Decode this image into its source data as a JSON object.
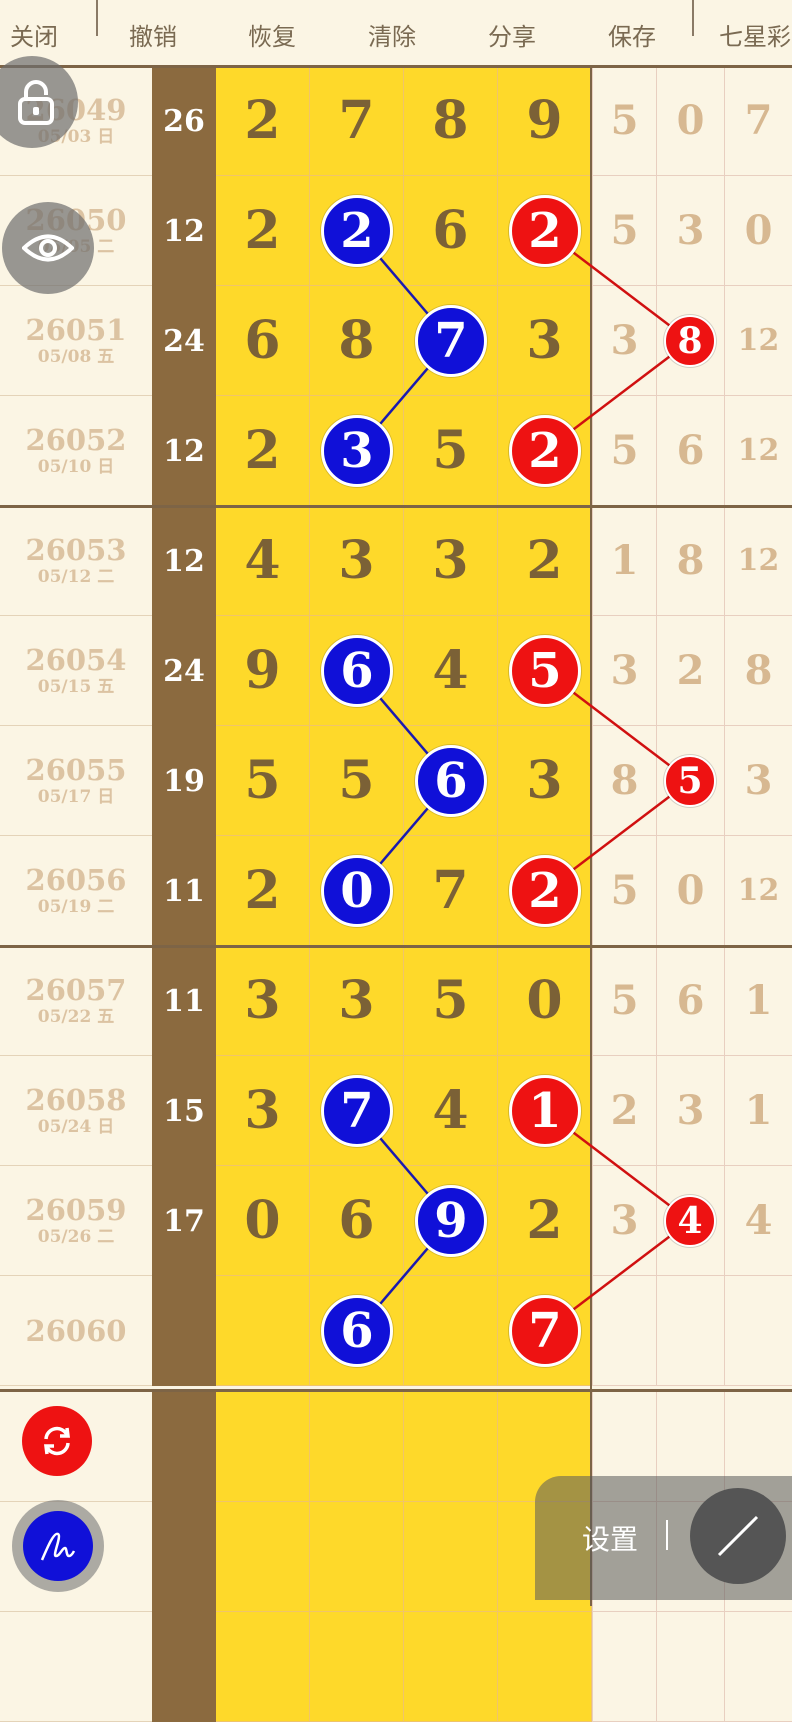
{
  "toolbar": {
    "items": [
      {
        "label": "关闭",
        "icon": "star-icon"
      },
      {
        "label": "撤销",
        "icon": "undo-icon"
      },
      {
        "label": "恢复",
        "icon": "redo-icon"
      },
      {
        "label": "清除",
        "icon": "clear-icon"
      },
      {
        "label": "分享",
        "icon": "share-icon"
      },
      {
        "label": "保存",
        "icon": "save-icon"
      },
      {
        "label": "七星彩",
        "icon": ""
      }
    ]
  },
  "rows": [
    {
      "issue": "26049",
      "date": "05/03 日",
      "sum": "26",
      "digits": [
        "2",
        "7",
        "8",
        "9"
      ],
      "extra": [
        "5",
        "0",
        "7"
      ]
    },
    {
      "issue": "26050",
      "date": "05/05 二",
      "sum": "12",
      "digits": [
        "2",
        "2",
        "6",
        "2"
      ],
      "extra": [
        "5",
        "3",
        "0"
      ]
    },
    {
      "issue": "26051",
      "date": "05/08 五",
      "sum": "24",
      "digits": [
        "6",
        "8",
        "7",
        "3"
      ],
      "extra": [
        "3",
        "8",
        "12"
      ]
    },
    {
      "issue": "26052",
      "date": "05/10 日",
      "sum": "12",
      "digits": [
        "2",
        "3",
        "5",
        "2"
      ],
      "extra": [
        "5",
        "6",
        "12"
      ]
    },
    {
      "issue": "26053",
      "date": "05/12 二",
      "sum": "12",
      "digits": [
        "4",
        "3",
        "3",
        "2"
      ],
      "extra": [
        "1",
        "8",
        "12"
      ]
    },
    {
      "issue": "26054",
      "date": "05/15 五",
      "sum": "24",
      "digits": [
        "9",
        "6",
        "4",
        "5"
      ],
      "extra": [
        "3",
        "2",
        "8"
      ]
    },
    {
      "issue": "26055",
      "date": "05/17 日",
      "sum": "19",
      "digits": [
        "5",
        "5",
        "6",
        "3"
      ],
      "extra": [
        "8",
        "5",
        "3"
      ]
    },
    {
      "issue": "26056",
      "date": "05/19 二",
      "sum": "11",
      "digits": [
        "2",
        "0",
        "7",
        "2"
      ],
      "extra": [
        "5",
        "0",
        "12"
      ]
    },
    {
      "issue": "26057",
      "date": "05/22 五",
      "sum": "11",
      "digits": [
        "3",
        "3",
        "5",
        "0"
      ],
      "extra": [
        "5",
        "6",
        "1"
      ]
    },
    {
      "issue": "26058",
      "date": "05/24 日",
      "sum": "15",
      "digits": [
        "3",
        "7",
        "4",
        "1"
      ],
      "extra": [
        "2",
        "3",
        "1"
      ]
    },
    {
      "issue": "26059",
      "date": "05/26 二",
      "sum": "17",
      "digits": [
        "0",
        "6",
        "9",
        "2"
      ],
      "extra": [
        "3",
        "4",
        "4"
      ]
    },
    {
      "issue": "26060",
      "date": "",
      "sum": "",
      "digits": [
        "",
        "6",
        "",
        "7"
      ],
      "extra": [
        "",
        "",
        ""
      ]
    }
  ],
  "marks": {
    "blue": [
      {
        "row": 1,
        "col": 1,
        "value": "2"
      },
      {
        "row": 2,
        "col": 2,
        "value": "7"
      },
      {
        "row": 3,
        "col": 1,
        "value": "3"
      },
      {
        "row": 5,
        "col": 1,
        "value": "6"
      },
      {
        "row": 6,
        "col": 2,
        "value": "6"
      },
      {
        "row": 7,
        "col": 1,
        "value": "0"
      },
      {
        "row": 9,
        "col": 1,
        "value": "7"
      },
      {
        "row": 10,
        "col": 2,
        "value": "9"
      },
      {
        "row": 11,
        "col": 1,
        "value": "6"
      }
    ],
    "red": [
      {
        "row": 1,
        "col": 3,
        "value": "2"
      },
      {
        "row": 2,
        "col": 5,
        "value": "8"
      },
      {
        "row": 3,
        "col": 3,
        "value": "2"
      },
      {
        "row": 5,
        "col": 3,
        "value": "5"
      },
      {
        "row": 6,
        "col": 5,
        "value": "5"
      },
      {
        "row": 7,
        "col": 3,
        "value": "2"
      },
      {
        "row": 9,
        "col": 3,
        "value": "1"
      },
      {
        "row": 10,
        "col": 5,
        "value": "4"
      },
      {
        "row": 11,
        "col": 3,
        "value": "7"
      }
    ]
  },
  "colors": {
    "highlight_yellow": "#fed92a",
    "sum_column": "#8b6a3f",
    "blue_ball": "#1010d8",
    "red_ball": "#ee1212"
  },
  "floating": {
    "lock_icon": "lock-icon",
    "eye_icon": "eye-icon",
    "refresh_icon": "refresh-icon",
    "signature_icon": "signature-icon",
    "pen_icon": "pen-icon",
    "settings_label": "设置"
  }
}
